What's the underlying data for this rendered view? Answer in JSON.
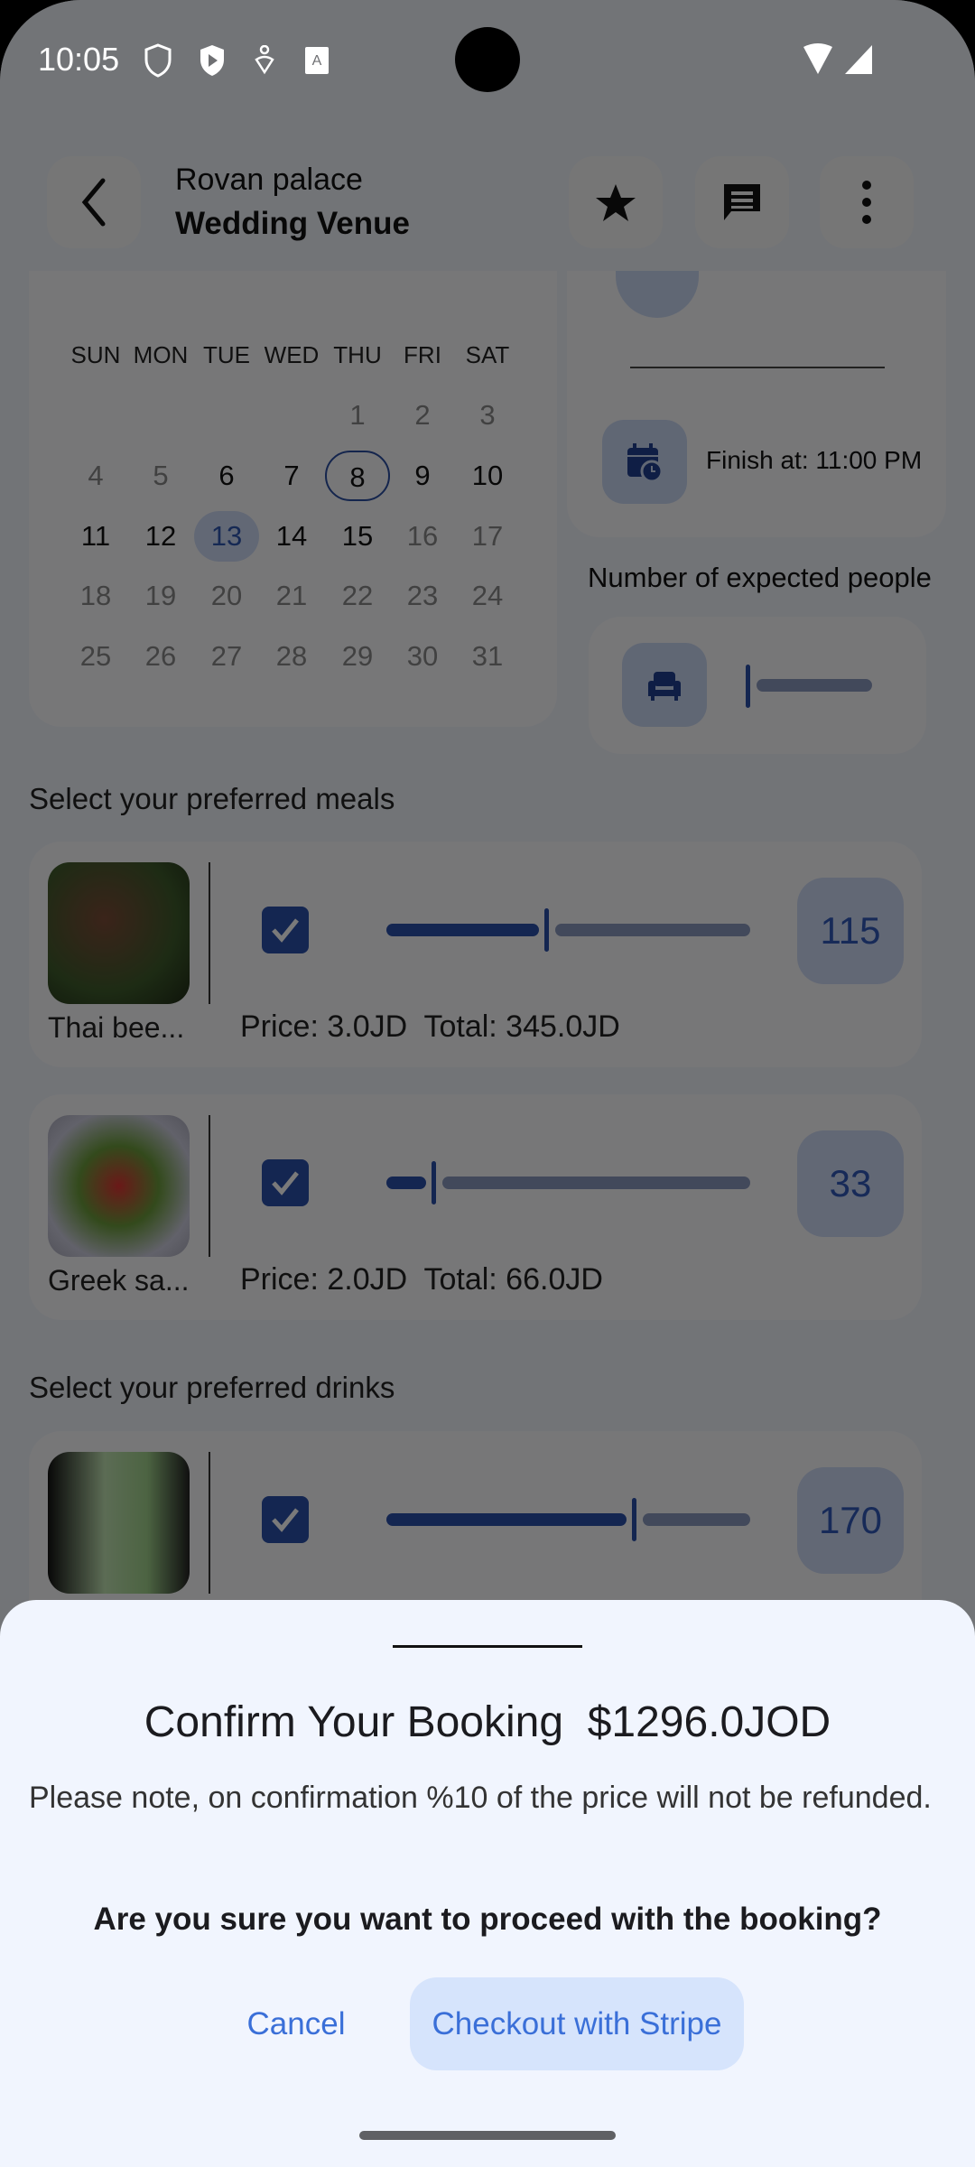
{
  "status_bar": {
    "time": "10:05",
    "icons": [
      "shield-icon",
      "play-shield-icon",
      "accessibility-icon",
      "keyboard-a-icon",
      "wifi-icon",
      "signal-icon"
    ]
  },
  "header": {
    "subtitle": "Rovan palace",
    "title": "Wedding Venue",
    "icons": [
      "back-icon",
      "star-icon",
      "chat-icon",
      "more-icon"
    ]
  },
  "calendar": {
    "weekdays": [
      "SUN",
      "MON",
      "TUE",
      "WED",
      "THU",
      "FRI",
      "SAT"
    ],
    "weeks": [
      [
        "",
        "",
        "",
        "",
        "1",
        "2",
        "3"
      ],
      [
        "4",
        "5",
        "6",
        "7",
        "8",
        "9",
        "10"
      ],
      [
        "11",
        "12",
        "13",
        "14",
        "15",
        "16",
        "17"
      ],
      [
        "18",
        "19",
        "20",
        "21",
        "22",
        "23",
        "24"
      ],
      [
        "25",
        "26",
        "27",
        "28",
        "29",
        "30",
        "31"
      ]
    ],
    "today": "8",
    "selected": "13",
    "enabled_range": [
      "6",
      "15"
    ]
  },
  "schedule": {
    "finish_label": "Finish at: 11:00 PM"
  },
  "people": {
    "label": "Number of expected people",
    "slider_fraction": 0
  },
  "meals": {
    "title": "Select your preferred meals",
    "items": [
      {
        "name": "Thai bee...",
        "price": "Price: 3.0JD",
        "total": "Total: 345.0JD",
        "count": "115",
        "checked": true,
        "slider_fraction": 0.44
      },
      {
        "name": "Greek sa...",
        "price": "Price: 2.0JD",
        "total": "Total: 66.0JD",
        "count": "33",
        "checked": true,
        "slider_fraction": 0.13
      }
    ]
  },
  "drinks": {
    "title": "Select your preferred drinks",
    "items": [
      {
        "count": "170",
        "checked": true,
        "slider_fraction": 0.68
      }
    ]
  },
  "dialog": {
    "title": "Confirm Your Booking  $1296.0JOD",
    "note": "Please note, on confirmation %10 of the price will not be refunded.",
    "question": "Are you sure you want to proceed with the booking?",
    "cancel": "Cancel",
    "checkout": "Checkout with Stripe"
  },
  "colors": {
    "accent": "#2a4fa8",
    "button_bg": "#d6e4fc",
    "button_text": "#3a6fd8",
    "sheet_bg": "#f1f5fe"
  }
}
